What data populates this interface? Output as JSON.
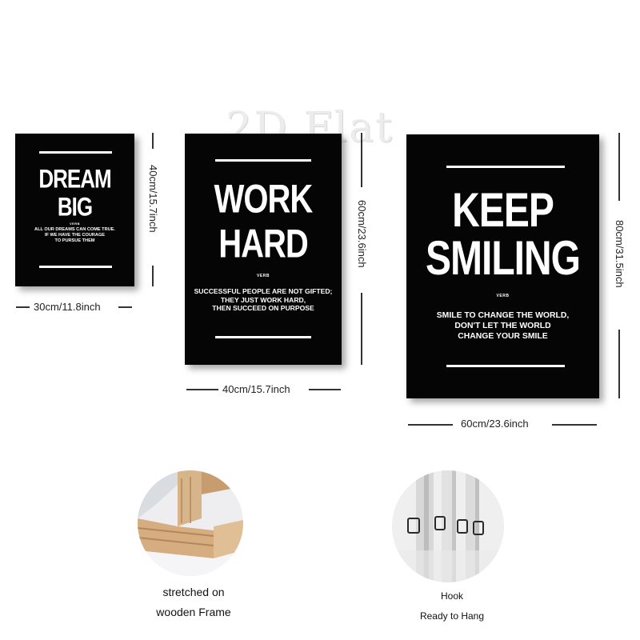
{
  "watermark": "2D Flat",
  "posters": [
    {
      "headline_1": "DREAM",
      "headline_2": "BIG",
      "verb": "VERB",
      "desc": "ALL OUR DREAMS CAN COME TRUE.\nIF WE HAVE THE COURAGE\nTO PURSUE THEM",
      "width_label": "30cm/11.8inch",
      "height_label": "40cm/15.7inch"
    },
    {
      "headline_1": "WORK",
      "headline_2": "HARD",
      "verb": "VERB",
      "desc": "SUCCESSFUL PEOPLE ARE NOT GIFTED;\nTHEY JUST WORK HARD,\nTHEN SUCCEED ON PURPOSE",
      "width_label": "40cm/15.7inch",
      "height_label": "60cm/23.6inch"
    },
    {
      "headline_1": "KEEP",
      "headline_2": "SMILING",
      "verb": "VERB",
      "desc": "SMILE TO CHANGE THE WORLD,\nDON'T LET THE WORLD\nCHANGE YOUR SMILE",
      "width_label": "60cm/23.6inch",
      "height_label": "80cm/31.5inch"
    }
  ],
  "features": [
    {
      "caption_1": "stretched on",
      "caption_2": "wooden Frame"
    },
    {
      "caption_1": "Hook",
      "caption_2": "Ready to Hang"
    }
  ],
  "colors": {
    "poster_bg": "#050505",
    "text": "#ffffff",
    "wood": "#d8b48a"
  }
}
